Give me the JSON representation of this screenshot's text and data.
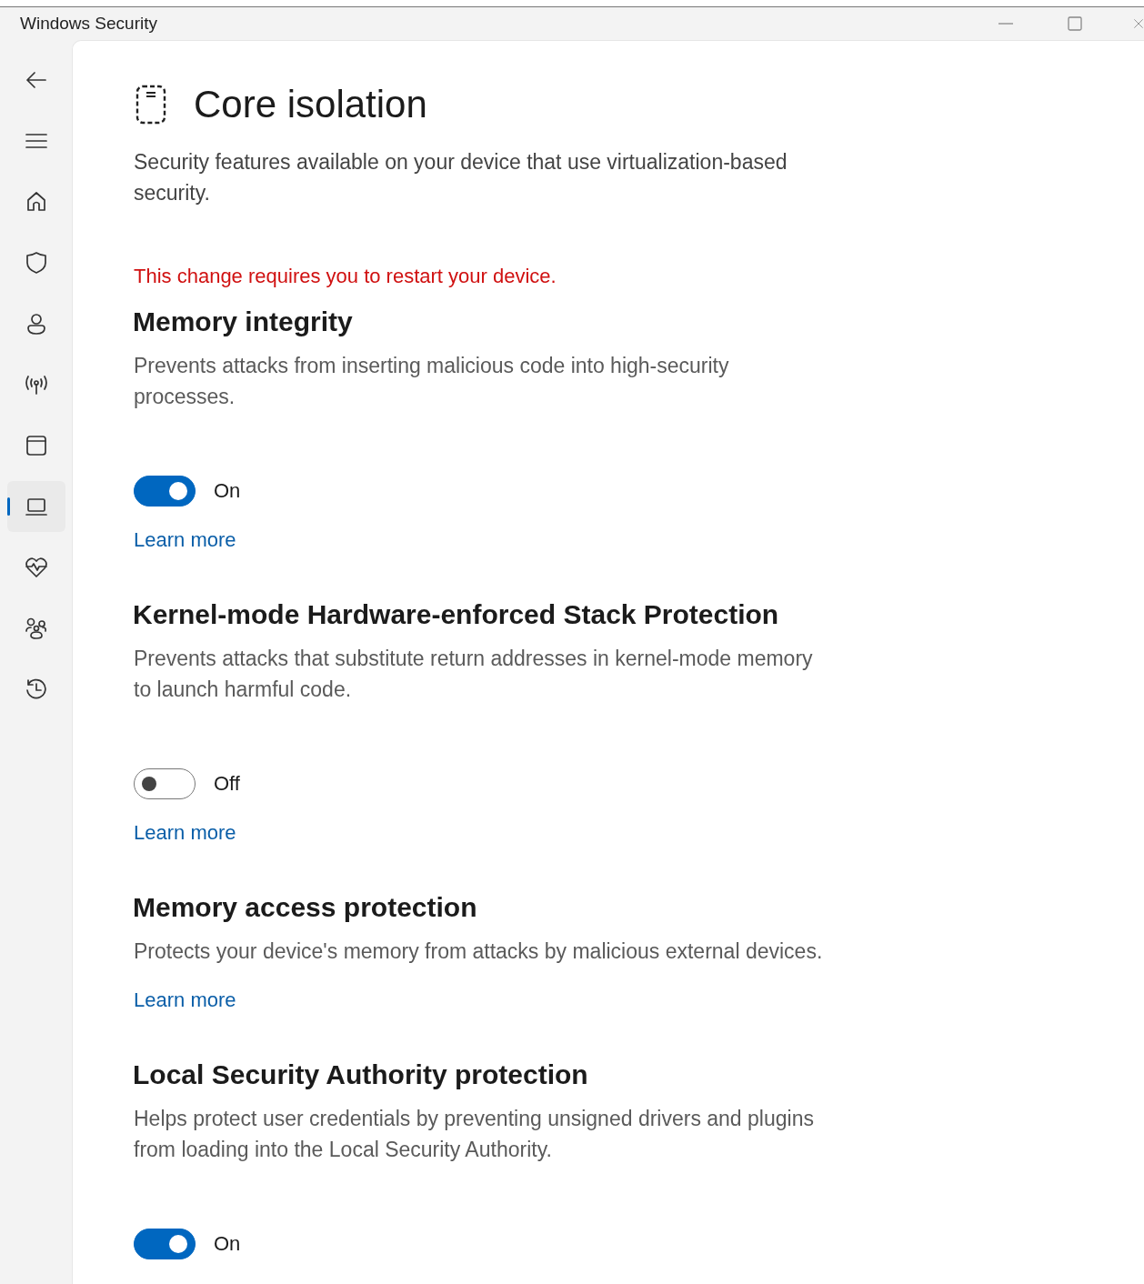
{
  "window": {
    "title": "Windows Security"
  },
  "sidebar": {
    "items": [
      {
        "selected": false
      },
      {
        "selected": false
      },
      {
        "selected": false
      },
      {
        "selected": false
      },
      {
        "selected": false
      },
      {
        "selected": true
      },
      {
        "selected": false
      },
      {
        "selected": false
      },
      {
        "selected": false
      }
    ]
  },
  "page": {
    "title": "Core isolation",
    "description": "Security features available on your device that use virtualization-based security.",
    "warning": "This change requires you to restart your device."
  },
  "sections": [
    {
      "title": "Memory integrity",
      "description": "Prevents attacks from inserting malicious code into high-security processes.",
      "toggle": {
        "on": true,
        "label": "On"
      },
      "link": "Learn more"
    },
    {
      "title": "Kernel-mode Hardware-enforced Stack Protection",
      "description": "Prevents attacks that substitute return addresses in kernel-mode memory to launch harmful code.",
      "toggle": {
        "on": false,
        "label": "Off"
      },
      "link": "Learn more"
    },
    {
      "title": "Memory access protection",
      "description": "Protects your device's memory from attacks by malicious external devices.",
      "link": "Learn more"
    },
    {
      "title": "Local Security Authority protection",
      "description": "Helps protect user credentials by preventing unsigned drivers and plugins from loading into the Local Security Authority.",
      "toggle": {
        "on": true,
        "label": "On"
      }
    }
  ]
}
